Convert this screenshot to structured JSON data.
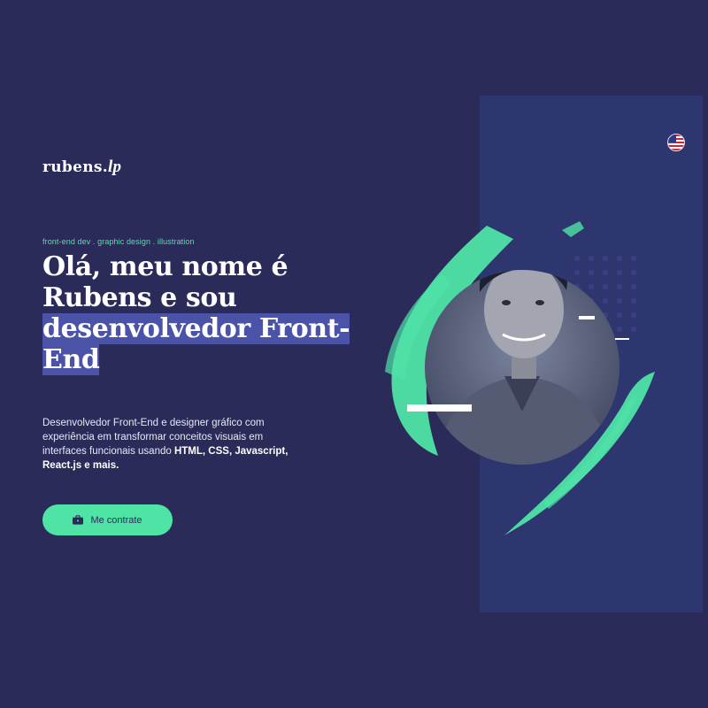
{
  "brand": {
    "name": "rubens.",
    "accent": "lp"
  },
  "hero": {
    "tagline": "front-end dev . graphic design . illustration",
    "headline_plain": "Olá, meu nome é Rubens e sou ",
    "headline_highlight": "desenvolvedor Front-End",
    "description_plain": "Desenvolvedor Front-End e designer gráfico com experiência em transformar conceitos visuais em interfaces funcionais usando ",
    "description_bold": "HTML, CSS, Javascript, React.js e mais.",
    "cta_label": "Me contrate"
  },
  "language": {
    "icon": "us-flag-icon"
  },
  "icons": {
    "cta": "briefcase-icon"
  },
  "colors": {
    "background": "#2b2b5a",
    "panel": "#2e3670",
    "accent": "#4fe3a6",
    "highlight": "#4a53a8"
  }
}
